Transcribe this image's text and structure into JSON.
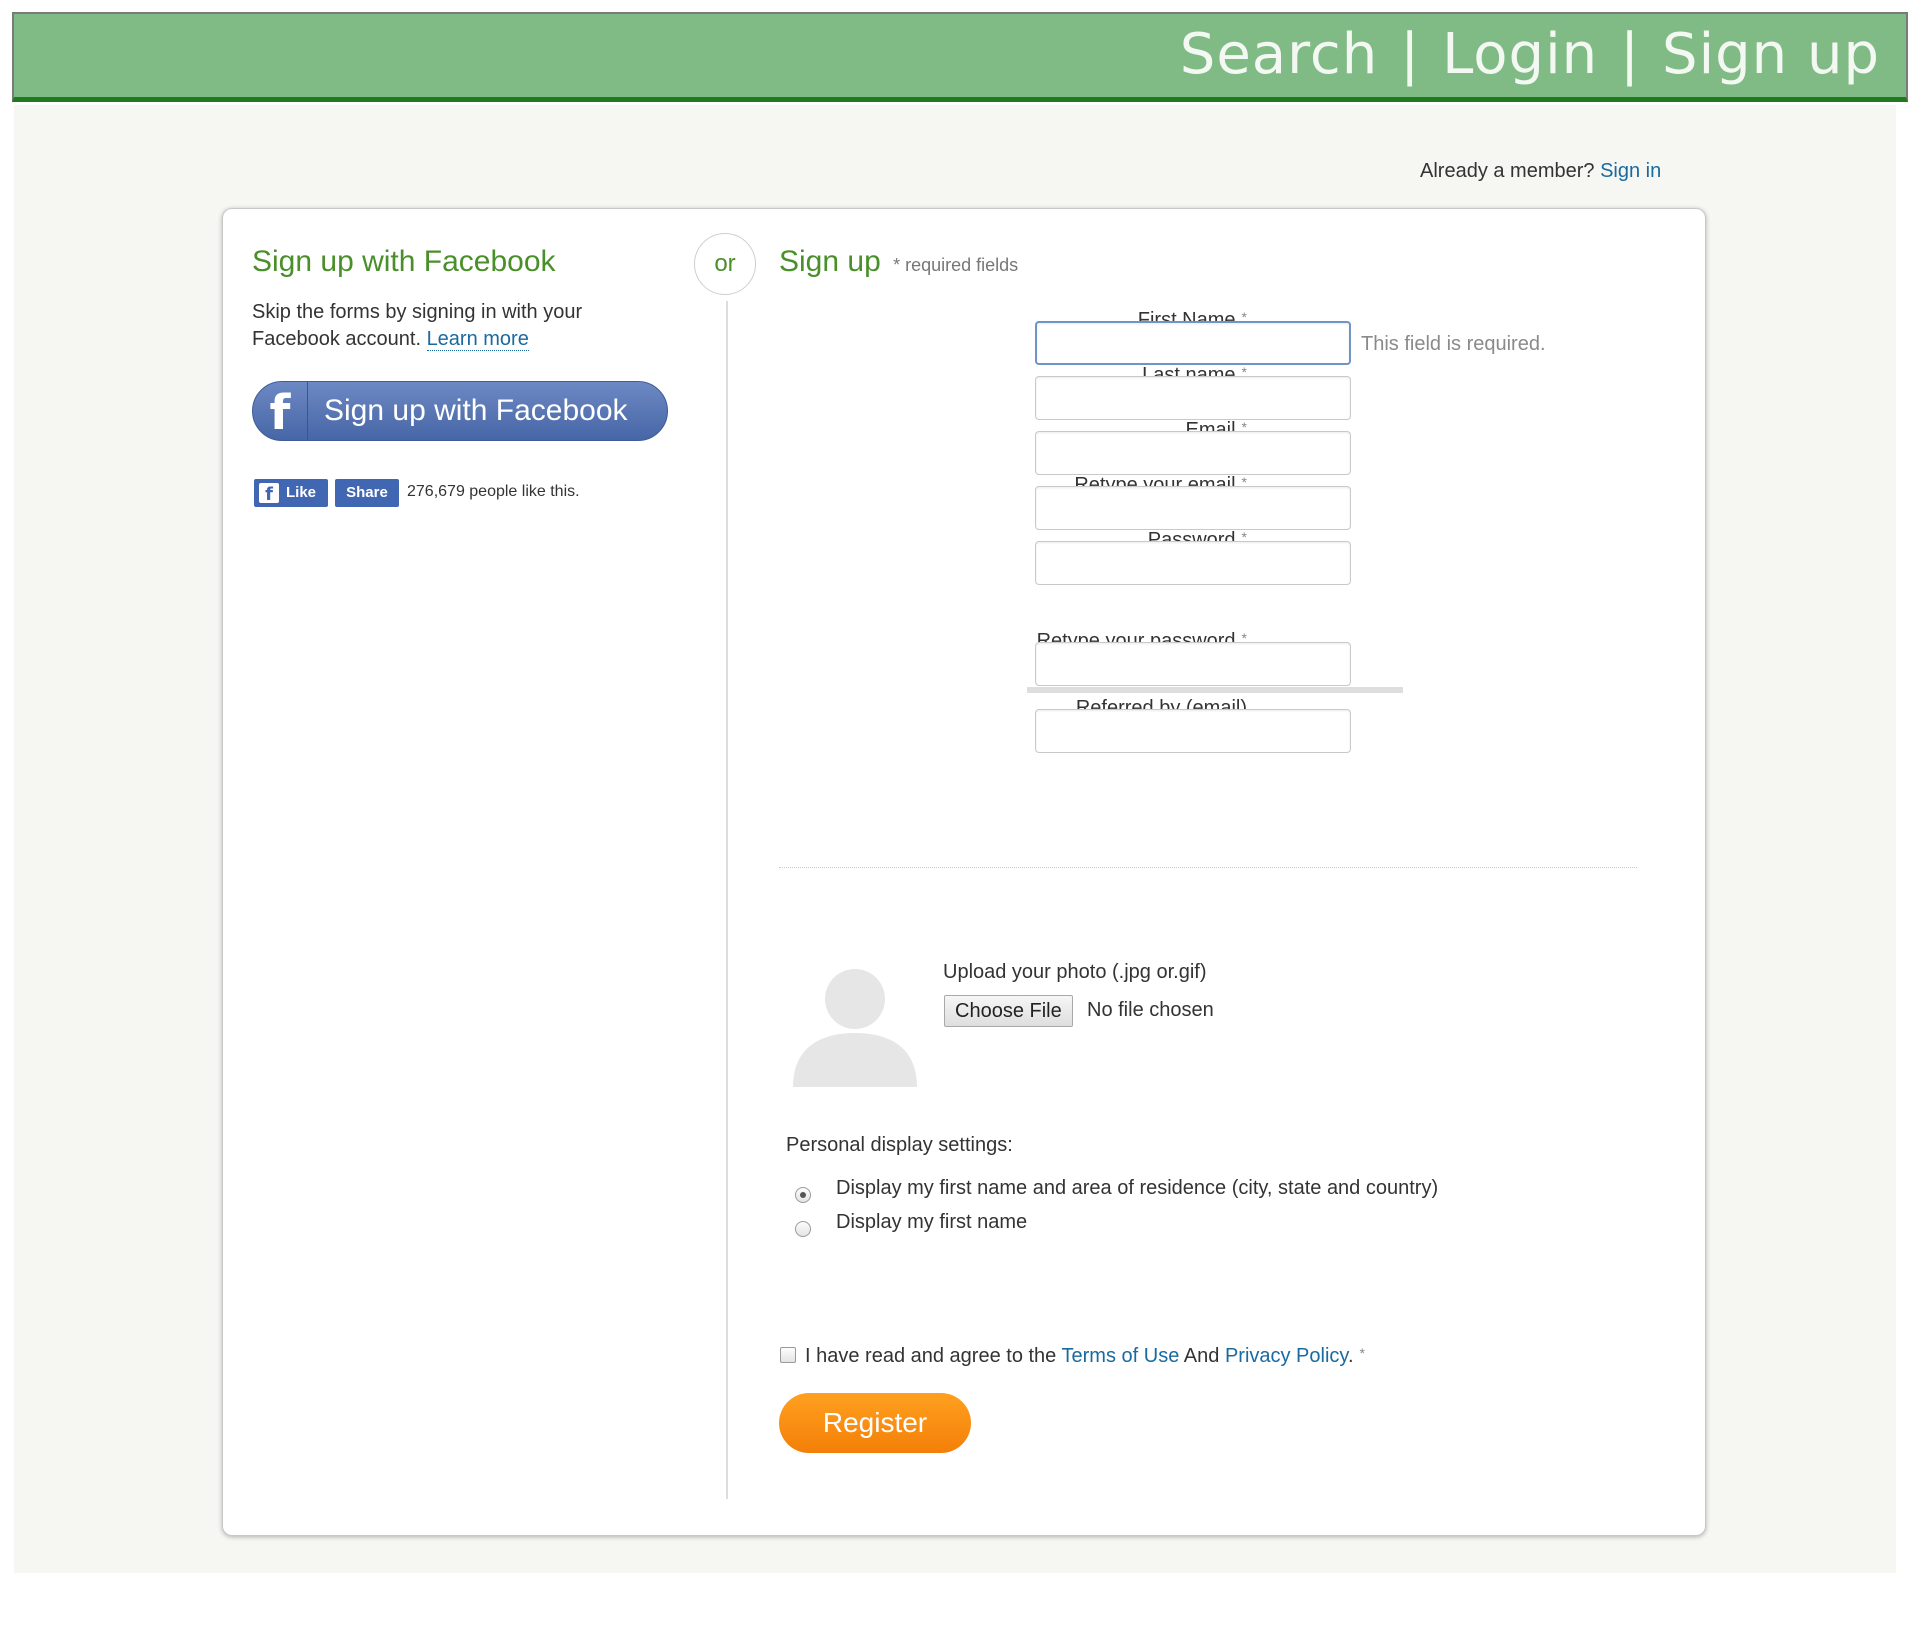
{
  "header": {
    "nav": [
      {
        "label": "Search"
      },
      {
        "label": "Login"
      },
      {
        "label": "Sign up"
      }
    ],
    "separator": "|"
  },
  "already_member": {
    "text": "Already a member?",
    "link": "Sign in"
  },
  "or_text": "or",
  "facebook": {
    "title": "Sign up with Facebook",
    "desc": "Skip the forms by signing in with your Facebook account.",
    "learn_more": "Learn more",
    "button_label": "Sign up with Facebook",
    "icon_glyph": "f",
    "like_label": "Like",
    "share_label": "Share",
    "like_count": "276,679 people like this.",
    "brand_color": "#4267b2"
  },
  "signup": {
    "title": "Sign up",
    "required_note": "* required fields",
    "required_mark": "*",
    "fields": [
      {
        "label": "First Name",
        "value": ""
      },
      {
        "label": "Last name",
        "value": ""
      },
      {
        "label": "Email",
        "value": ""
      },
      {
        "label": "Retype your email",
        "value": ""
      },
      {
        "label": "Password",
        "value": ""
      },
      {
        "label": "Retype your password",
        "value": ""
      }
    ],
    "referred": {
      "label": "Referred by (email)",
      "value": ""
    },
    "error": "This field is required.",
    "upload_label": "Upload your photo (.jpg or.gif)",
    "choose_file": "Choose File",
    "no_file": "No file chosen",
    "display_settings_label": "Personal display settings:",
    "display_options": [
      {
        "label": "Display my first name and area of residence (city, state and country)",
        "checked": true
      },
      {
        "label": "Display my first name",
        "checked": false
      }
    ],
    "agree": {
      "prefix": "I have read and agree to the",
      "terms": "Terms of Use",
      "and": "And",
      "privacy": "Privacy Policy",
      "suffix": "."
    },
    "register_label": "Register"
  },
  "colors": {
    "header_green": "#80bb85",
    "title_green": "#4a8f2a",
    "link_blue": "#1a6aa0",
    "register_orange": "#f88f10"
  }
}
